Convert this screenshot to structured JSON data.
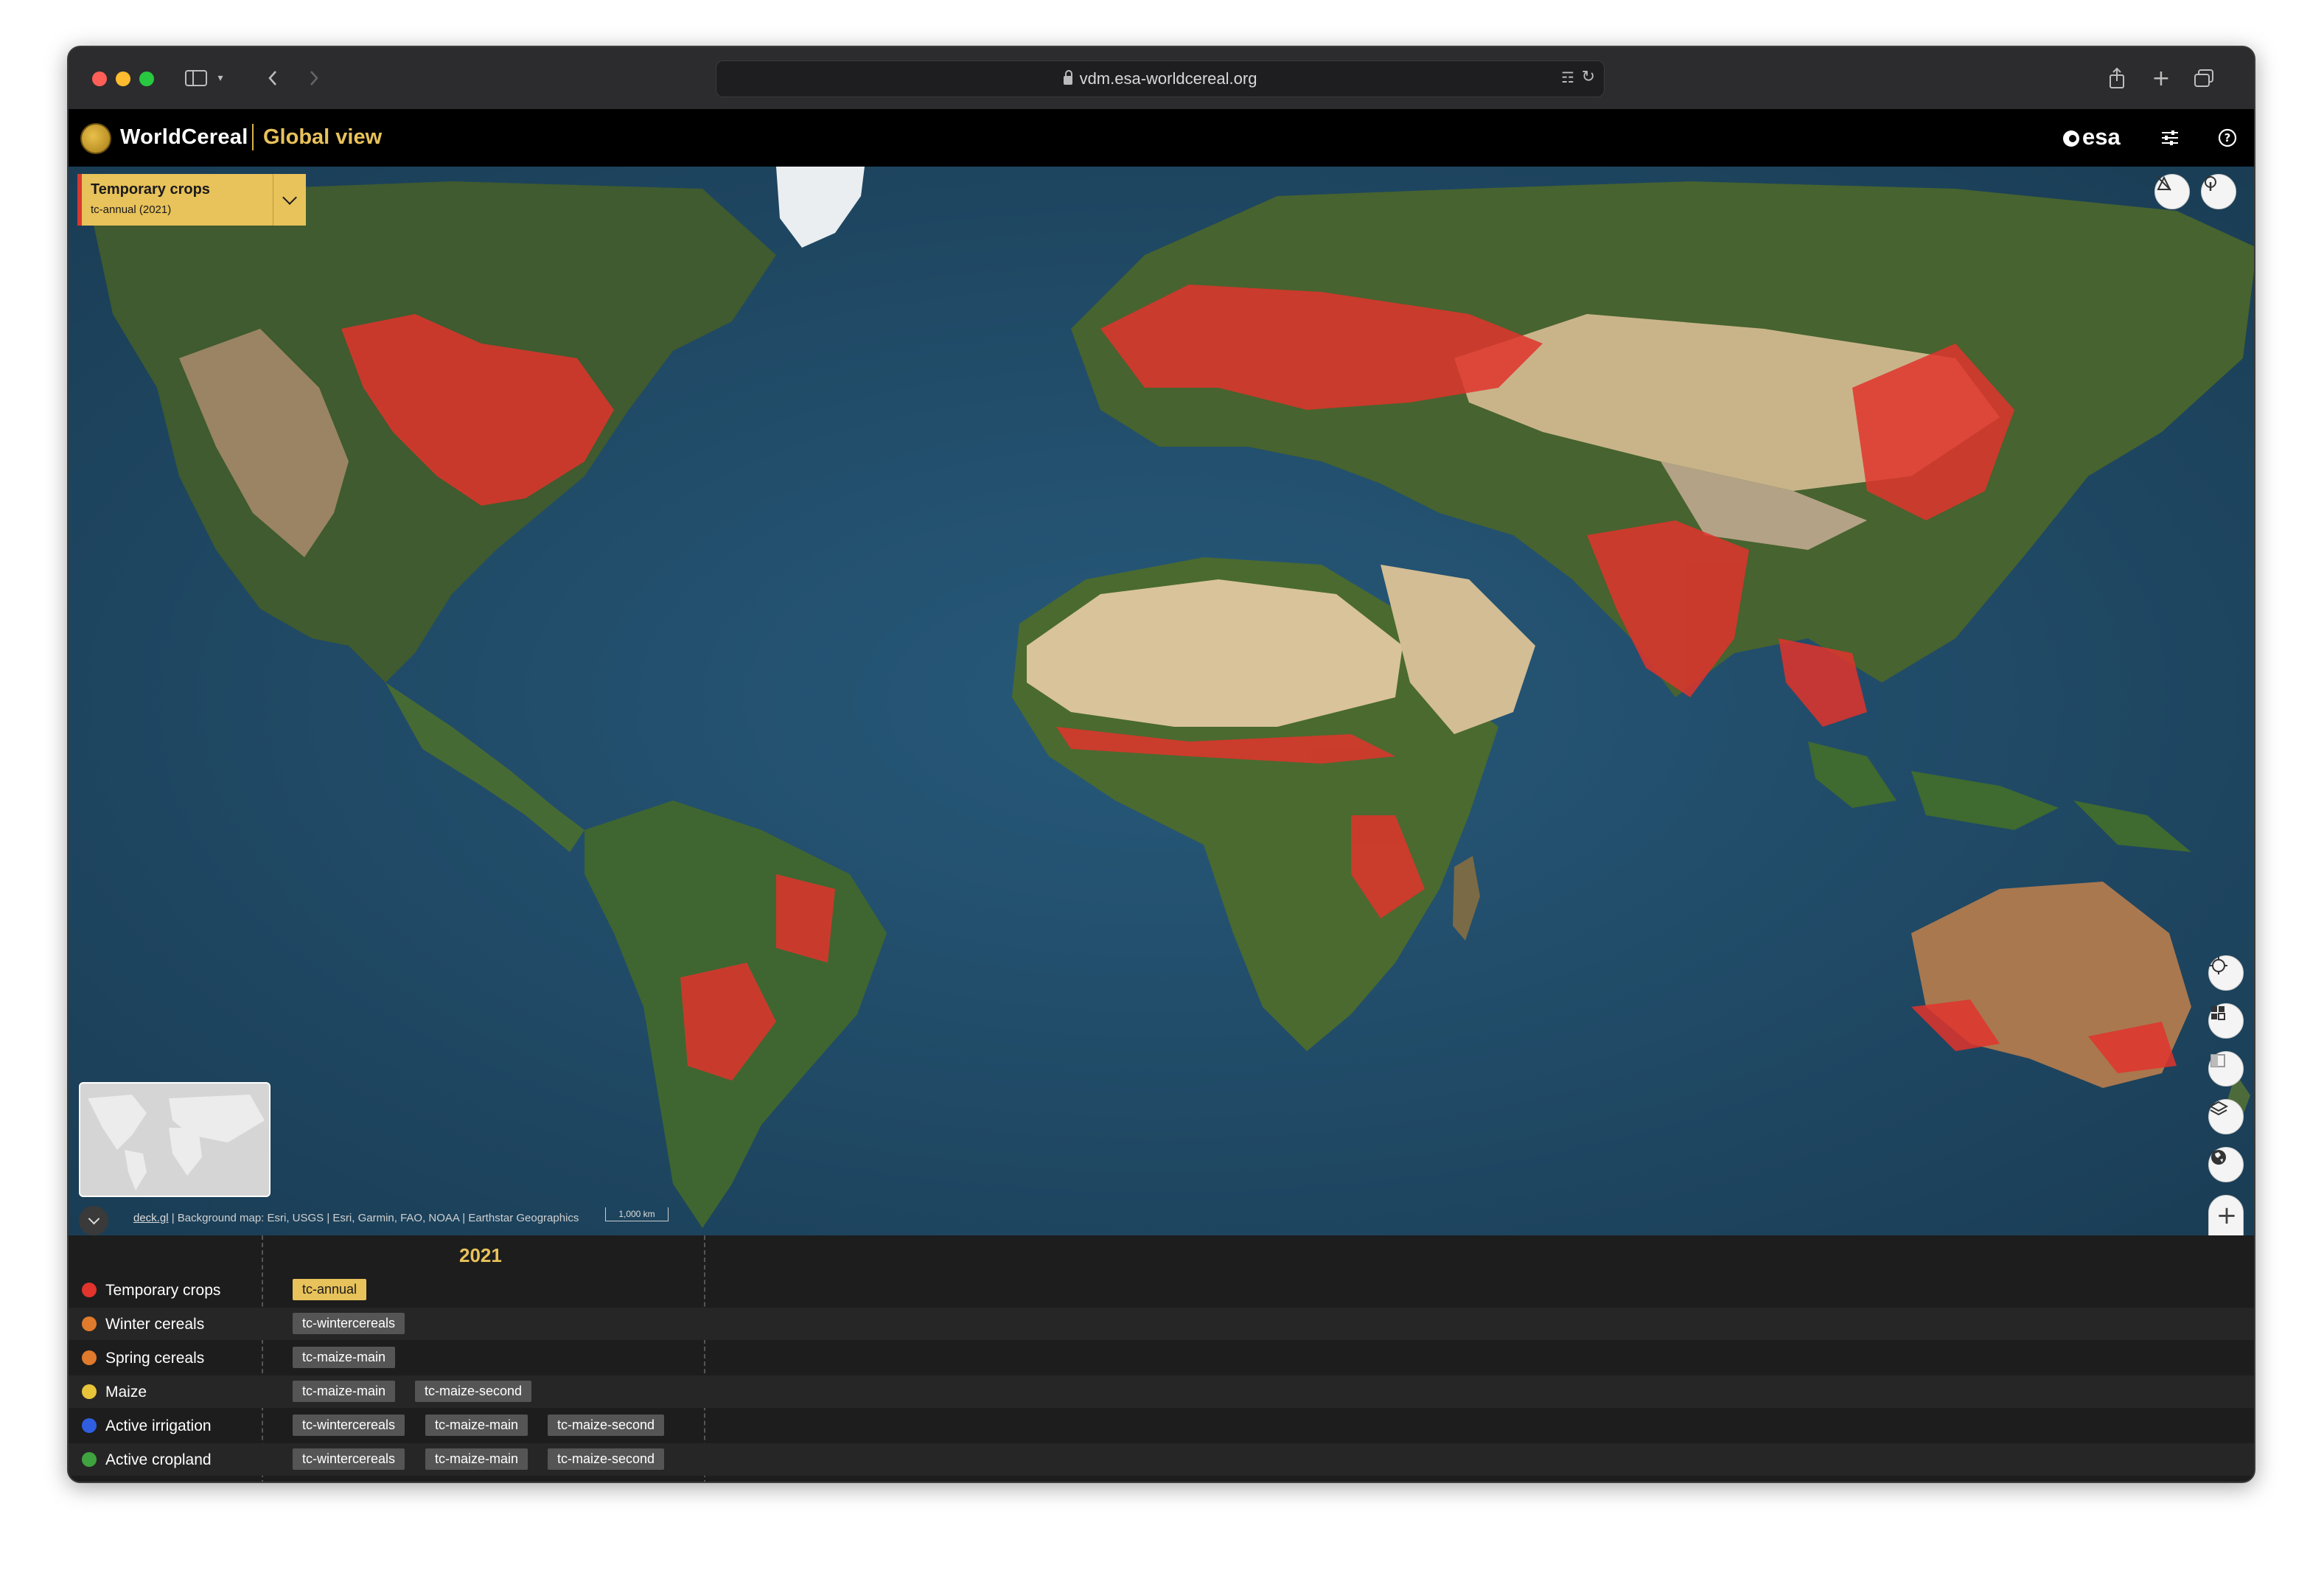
{
  "browser": {
    "url": "vdm.esa-worldcereal.org",
    "traffic_colors": [
      "#ff5f57",
      "#febc2e",
      "#28c840"
    ]
  },
  "header": {
    "brand": "WorldCereal",
    "view": "Global view",
    "esa_logo": "esa",
    "icons": [
      "sliders-icon",
      "help-icon"
    ]
  },
  "layer_selector": {
    "title": "Temporary crops",
    "subtitle": "tc-annual (2021)"
  },
  "map": {
    "attribution_link": "deck.gl",
    "attribution": " | Background map: Esri, USGS | Esri, Garmin, FAO, NOAA | Earthstar Geographics",
    "scale": "1,000 km",
    "crop_color": "#e0342c",
    "controls": [
      "locate-icon",
      "grid-icon",
      "compare-icon",
      "layers-icon",
      "globe-icon",
      "zoom-in",
      "zoom-out"
    ]
  },
  "timeline": {
    "year": "2021",
    "rows": [
      {
        "label": "Temporary crops",
        "color": "#e0342c",
        "chips": [
          "tc-annual"
        ]
      },
      {
        "label": "Winter cereals",
        "color": "#e07a2c",
        "chips": [
          "tc-wintercereals"
        ]
      },
      {
        "label": "Spring cereals",
        "color": "#e07a2c",
        "chips": [
          "tc-maize-main"
        ]
      },
      {
        "label": "Maize",
        "color": "#e8c43a",
        "chips": [
          "tc-maize-main",
          "tc-maize-second"
        ]
      },
      {
        "label": "Active irrigation",
        "color": "#2f5fe0",
        "chips": [
          "tc-wintercereals",
          "tc-maize-main",
          "tc-maize-second"
        ]
      },
      {
        "label": "Active cropland",
        "color": "#3fa33f",
        "chips": [
          "tc-wintercereals",
          "tc-maize-main",
          "tc-maize-second"
        ]
      }
    ]
  }
}
